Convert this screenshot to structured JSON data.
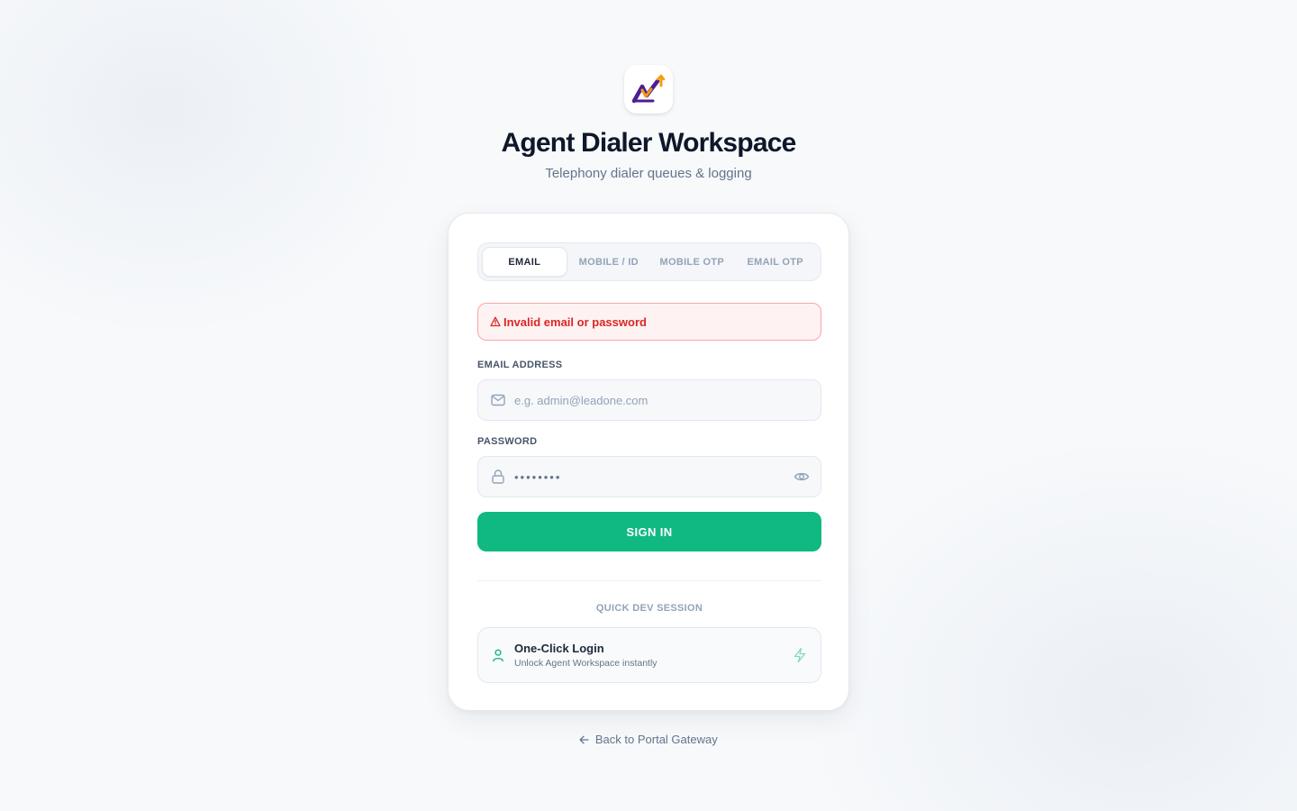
{
  "brand": {
    "logo_icon": "trend-up-chart-icon",
    "title": "Agent Dialer Workspace",
    "subtitle": "Telephony dialer queues & logging",
    "colors": {
      "logo_primary": "#4c1d95",
      "logo_accent": "#f59e0b"
    }
  },
  "tabs": [
    {
      "label": "EMAIL",
      "active": true
    },
    {
      "label": "MOBILE / ID",
      "active": false
    },
    {
      "label": "MOBILE OTP",
      "active": false
    },
    {
      "label": "EMAIL OTP",
      "active": false
    }
  ],
  "error": {
    "icon": "warning-triangle-icon",
    "message": "Invalid email or password",
    "color": "#dc2626"
  },
  "form": {
    "email_label": "EMAIL ADDRESS",
    "email_icon": "mail-icon",
    "email_value": "",
    "email_placeholder": "e.g. admin@leadone.com",
    "password_label": "PASSWORD",
    "password_icon": "lock-icon",
    "password_value": "••••••••",
    "password_toggle_icon": "eye-icon",
    "submit_label": "SIGN IN",
    "submit_color": "#10b981"
  },
  "quick_session": {
    "section_label": "QUICK DEV SESSION",
    "icon": "user-icon",
    "title": "One-Click Login",
    "description": "Unlock Agent Workspace instantly",
    "action_icon": "lightning-bolt-icon"
  },
  "footer": {
    "back_link": "Back to Portal Gateway",
    "back_icon": "arrow-left-icon"
  }
}
